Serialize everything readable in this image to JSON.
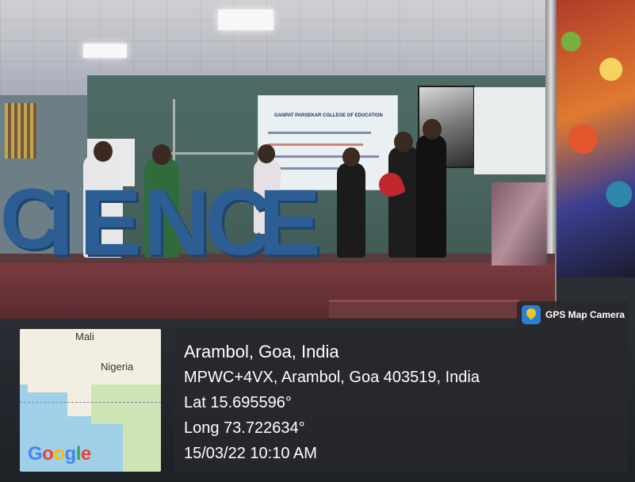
{
  "photo": {
    "stage_sign_letters": [
      "C",
      "I",
      "E",
      "N",
      "C",
      "E"
    ],
    "banner_title": "GANPAT PARSEKAR COLLEGE OF EDUCATION"
  },
  "gps_badge": {
    "label": "GPS Map Camera"
  },
  "map": {
    "labels": [
      "Mali",
      "Nigeria"
    ],
    "logo_text": "Google"
  },
  "location": {
    "title": "Arambol, Goa, India",
    "address": "MPWC+4VX, Arambol, Goa 403519, India",
    "latitude": "Lat 15.695596°",
    "longitude": "Long 73.722634°",
    "datetime": "15/03/22 10:10 AM"
  }
}
